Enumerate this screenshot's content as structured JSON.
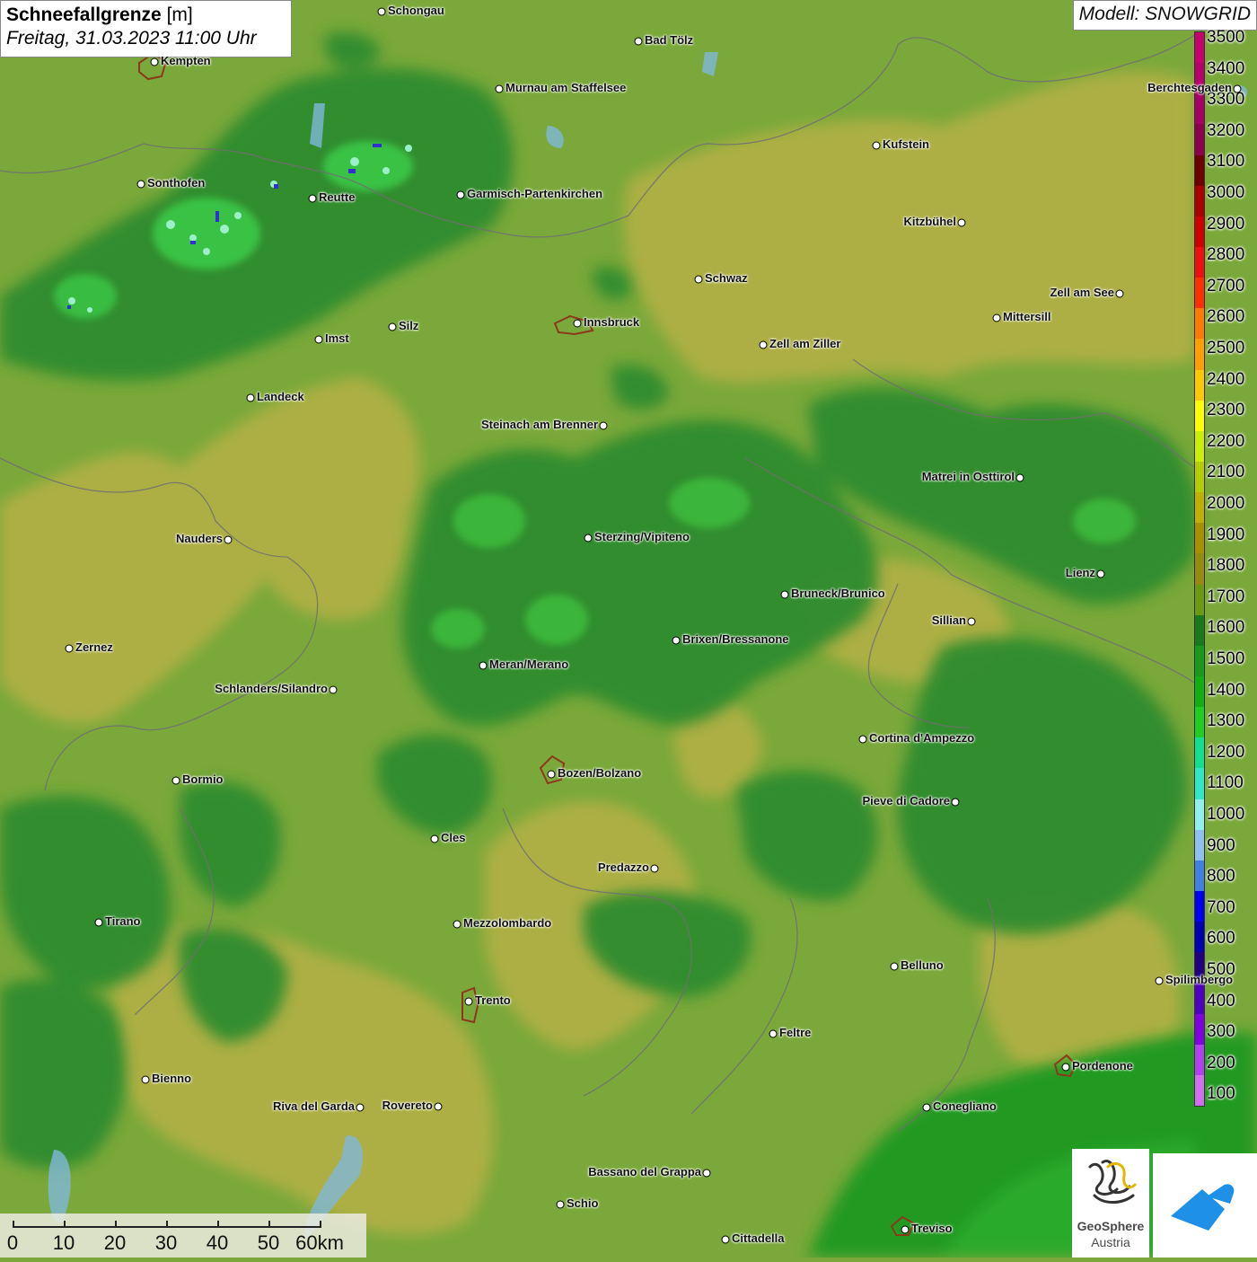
{
  "title": {
    "variable": "Schneefallgrenze",
    "unit": "[m]",
    "datetime": "Freitag, 31.03.2023 11:00 Uhr"
  },
  "model_label": "Modell: SNOWGRID",
  "legend": {
    "labels": [
      "3500",
      "3400",
      "3300",
      "3200",
      "3100",
      "3000",
      "2900",
      "2800",
      "2700",
      "2600",
      "2500",
      "2400",
      "2300",
      "2200",
      "2100",
      "2000",
      "1900",
      "1800",
      "1700",
      "1600",
      "1500",
      "1400",
      "1300",
      "1200",
      "1100",
      "1000",
      "900",
      "800",
      "700",
      "600",
      "500",
      "400",
      "300",
      "200",
      "100"
    ],
    "colors": [
      "#c8006e",
      "#b8006a",
      "#a60066",
      "#8c0050",
      "#6e0000",
      "#aa0000",
      "#d00000",
      "#ee1010",
      "#ff3000",
      "#ff7a00",
      "#ffa000",
      "#ffc800",
      "#ffff00",
      "#ccee00",
      "#b4cc00",
      "#c0b000",
      "#a89000",
      "#988a10",
      "#6a9a10",
      "#1a7a1a",
      "#1a9a1a",
      "#10b010",
      "#20d020",
      "#10e090",
      "#30e8c8",
      "#90f0f0",
      "#90c0f0",
      "#4080e0",
      "#0000ee",
      "#0000b0",
      "#200080",
      "#5000c0",
      "#8000e0",
      "#b040f0",
      "#d070f0"
    ]
  },
  "cities": [
    {
      "name": "Schongau",
      "side": "right"
    },
    {
      "name": "Bad Tölz",
      "side": "right"
    },
    {
      "name": "Kempten",
      "side": "right"
    },
    {
      "name": "Murnau am Staffelsee",
      "side": "right"
    },
    {
      "name": "Kufstein",
      "side": "right"
    },
    {
      "name": "Berchtesgaden",
      "side": "left"
    },
    {
      "name": "Sonthofen",
      "side": "right"
    },
    {
      "name": "Reutte",
      "side": "right"
    },
    {
      "name": "Garmisch-Partenkirchen",
      "side": "right"
    },
    {
      "name": "Kitzbühel",
      "side": "left"
    },
    {
      "name": "Schwaz",
      "side": "right"
    },
    {
      "name": "Zell am See",
      "side": "left"
    },
    {
      "name": "Innsbruck",
      "side": "right"
    },
    {
      "name": "Mittersill",
      "side": "right"
    },
    {
      "name": "Imst",
      "side": "right"
    },
    {
      "name": "Silz",
      "side": "right"
    },
    {
      "name": "Zell am Ziller",
      "side": "right"
    },
    {
      "name": "Landeck",
      "side": "right"
    },
    {
      "name": "Steinach am Brenner",
      "side": "left"
    },
    {
      "name": "Matrei in Osttirol",
      "side": "left"
    },
    {
      "name": "Nauders",
      "side": "left"
    },
    {
      "name": "Sterzing/Vipiteno",
      "side": "right"
    },
    {
      "name": "Lienz",
      "side": "left"
    },
    {
      "name": "Bruneck/Brunico",
      "side": "right"
    },
    {
      "name": "Sillian",
      "side": "left"
    },
    {
      "name": "Zernez",
      "side": "right"
    },
    {
      "name": "Brixen/Bressanone",
      "side": "right"
    },
    {
      "name": "Meran/Merano",
      "side": "right"
    },
    {
      "name": "Schlanders/Silandro",
      "side": "left"
    },
    {
      "name": "Cortina d'Ampezzo",
      "side": "right"
    },
    {
      "name": "Bozen/Bolzano",
      "side": "right"
    },
    {
      "name": "Bormio",
      "side": "right"
    },
    {
      "name": "Pieve di Cadore",
      "side": "left"
    },
    {
      "name": "Cles",
      "side": "right"
    },
    {
      "name": "Predazzo",
      "side": "left"
    },
    {
      "name": "Tirano",
      "side": "right"
    },
    {
      "name": "Mezzolombardo",
      "side": "right"
    },
    {
      "name": "Belluno",
      "side": "right"
    },
    {
      "name": "Spilimbergo",
      "side": "right"
    },
    {
      "name": "Trento",
      "side": "right"
    },
    {
      "name": "Feltre",
      "side": "right"
    },
    {
      "name": "Pordenone",
      "side": "right"
    },
    {
      "name": "Bienno",
      "side": "right"
    },
    {
      "name": "Riva del Garda",
      "side": "left"
    },
    {
      "name": "Rovereto",
      "side": "left"
    },
    {
      "name": "Conegliano",
      "side": "right"
    },
    {
      "name": "Bassano del Grappa",
      "side": "left"
    },
    {
      "name": "Schio",
      "side": "right"
    },
    {
      "name": "Treviso",
      "side": "right"
    },
    {
      "name": "Cittadella",
      "side": "right"
    }
  ],
  "scalebar": {
    "labels": [
      "0",
      "10",
      "20",
      "30",
      "40",
      "50",
      "60km"
    ]
  },
  "logos": {
    "geosphere_line1": "GeoSphere",
    "geosphere_line2": "Austria"
  }
}
